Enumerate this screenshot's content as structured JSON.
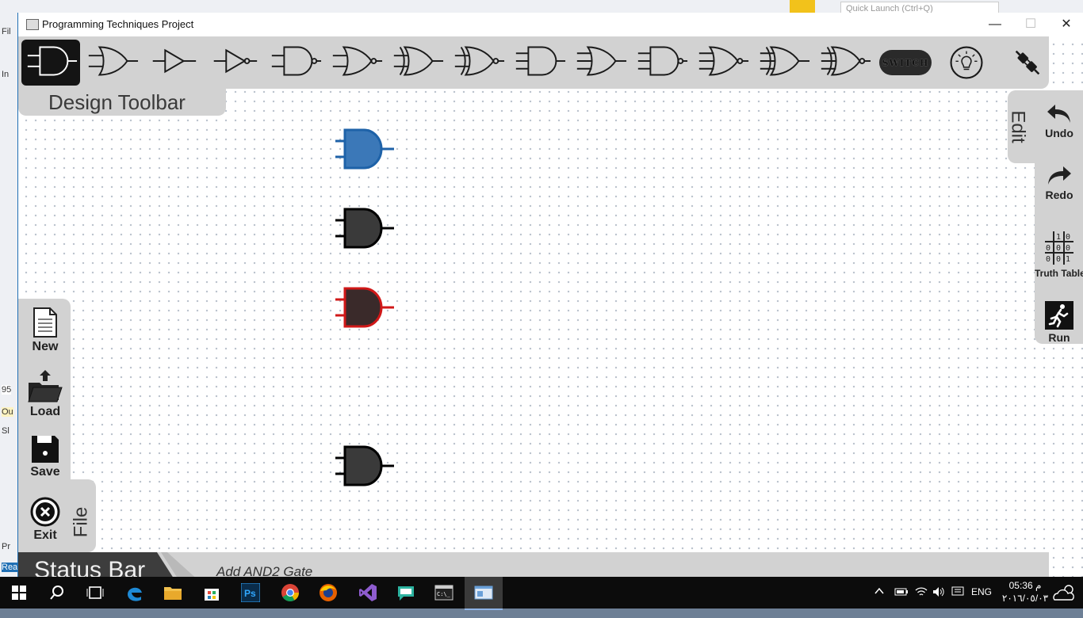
{
  "background_app": {
    "quick_launch_placeholder": "Quick Launch (Ctrl+Q)",
    "left_fragments": [
      "Fil",
      "In",
      "95",
      "Ou",
      "Sl",
      "Pr",
      "Rea"
    ]
  },
  "window": {
    "title": "Programming Techniques Project",
    "controls": {
      "minimize": "—",
      "maximize": "☐",
      "close": "✕"
    }
  },
  "toolbar": {
    "label": "Design Toolbar",
    "active_index": 0,
    "tools": [
      {
        "name": "and2-gate-icon",
        "type": "and"
      },
      {
        "name": "or2-gate-icon",
        "type": "or"
      },
      {
        "name": "buffer-gate-icon",
        "type": "buf"
      },
      {
        "name": "not-gate-icon",
        "type": "not"
      },
      {
        "name": "nand2-gate-icon",
        "type": "nand"
      },
      {
        "name": "nor2-gate-icon",
        "type": "nor"
      },
      {
        "name": "xor2-gate-icon",
        "type": "xor"
      },
      {
        "name": "xnor2-gate-icon",
        "type": "xnor"
      },
      {
        "name": "and3-gate-icon",
        "type": "and3"
      },
      {
        "name": "or3-gate-icon",
        "type": "or3"
      },
      {
        "name": "nand3-gate-icon",
        "type": "nand3"
      },
      {
        "name": "nor3-gate-icon",
        "type": "nor3"
      },
      {
        "name": "xor3-gate-icon",
        "type": "xor3"
      },
      {
        "name": "xnor3-gate-icon",
        "type": "xnor3"
      }
    ],
    "switch_label": "SWITCH",
    "led_icon": "led-bulb-icon",
    "wire_icon": "wire-connector-icon"
  },
  "edit_panel": {
    "tab_label": "Edit",
    "buttons": [
      {
        "label": "Undo",
        "icon": "undo-icon"
      },
      {
        "label": "Redo",
        "icon": "redo-icon"
      },
      {
        "label": "Truth Table",
        "icon": "truth-table-icon"
      },
      {
        "label": "Run",
        "icon": "run-icon"
      }
    ]
  },
  "file_panel": {
    "tab_label": "File",
    "buttons": [
      {
        "label": "New",
        "icon": "new-document-icon"
      },
      {
        "label": "Load",
        "icon": "open-folder-icon"
      },
      {
        "label": "Save",
        "icon": "floppy-disk-icon"
      },
      {
        "label": "Exit",
        "icon": "exit-icon"
      }
    ]
  },
  "status_bar": {
    "label": "Status Bar",
    "message": "Add AND2 Gate"
  },
  "canvas_gates": [
    {
      "type": "and2",
      "state": "selected",
      "fill": "#3b78b8",
      "stroke": "#1e62a8"
    },
    {
      "type": "and2",
      "state": "normal",
      "fill": "#3a3a3a",
      "stroke": "#000000"
    },
    {
      "type": "and2",
      "state": "error",
      "fill": "#3a2a2a",
      "stroke": "#d01818"
    },
    {
      "type": "and2",
      "state": "normal",
      "fill": "#3a3a3a",
      "stroke": "#000000"
    }
  ],
  "taskbar": {
    "language": "ENG",
    "time": "05:36 م",
    "date": "٢٠١٦/٠٥/٠٣",
    "apps": [
      "windows-start-icon",
      "search-icon",
      "task-view-icon",
      "edge-icon",
      "file-explorer-icon",
      "store-icon",
      "photoshop-icon",
      "chrome-icon",
      "firefox-icon",
      "visual-studio-icon",
      "chat-icon",
      "cmd-icon",
      "app-window-icon"
    ]
  },
  "colors": {
    "panel": "#d2d2d2",
    "status_label_bg": "#3d3d3d",
    "accent_blue": "#3b78b8",
    "error_red": "#d01818"
  }
}
